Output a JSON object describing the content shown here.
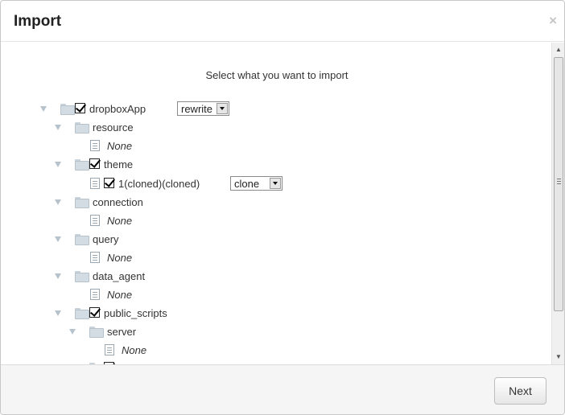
{
  "dialog": {
    "title": "Import",
    "close_glyph": "×",
    "subtitle": "Select what you want to import"
  },
  "tree": [
    {
      "label": "dropboxApp",
      "checked": true,
      "icon": "folder-icon",
      "select": "rewrite"
    },
    {
      "label": "resource",
      "icon": "folder-icon"
    },
    {
      "label": "None",
      "icon": "document-icon"
    },
    {
      "label": "theme",
      "checked": true,
      "icon": "folder-icon"
    },
    {
      "label": "1(cloned)(cloned)",
      "checked": true,
      "icon": "document-icon",
      "select": "clone"
    },
    {
      "label": "connection",
      "icon": "folder-icon"
    },
    {
      "label": "None",
      "icon": "document-icon"
    },
    {
      "label": "query",
      "icon": "folder-icon"
    },
    {
      "label": "None",
      "icon": "document-icon"
    },
    {
      "label": "data_agent",
      "icon": "folder-icon"
    },
    {
      "label": "None",
      "icon": "document-icon"
    },
    {
      "label": "public_scripts",
      "checked": true,
      "icon": "folder-icon"
    },
    {
      "label": "server",
      "icon": "folder-icon"
    },
    {
      "label": "None",
      "icon": "document-icon"
    }
  ],
  "footer": {
    "next_label": "Next"
  }
}
